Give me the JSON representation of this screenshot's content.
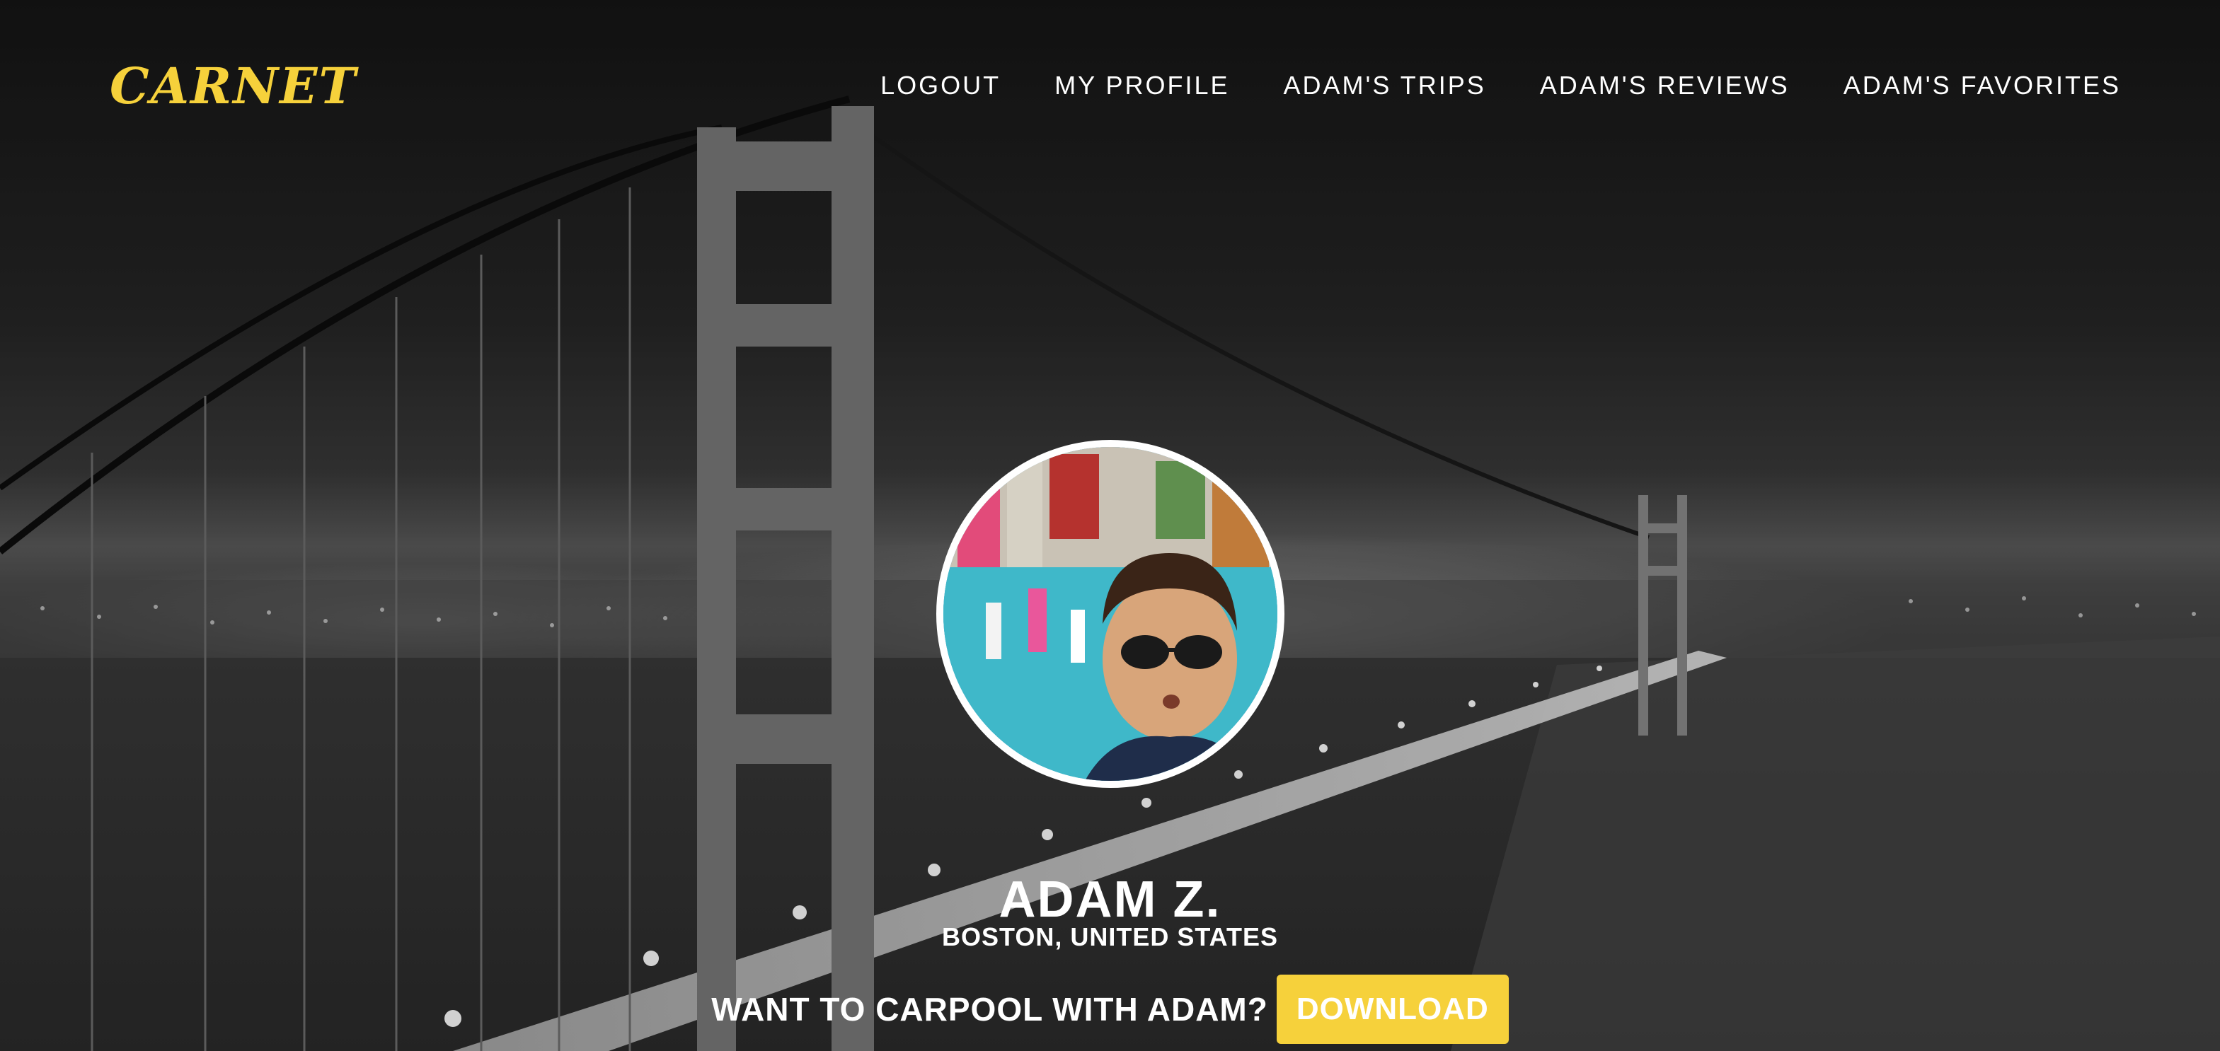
{
  "brand": {
    "logo_text": "CARNET",
    "accent_color": "#f6d13b"
  },
  "nav": {
    "items": [
      {
        "label": "LOGOUT"
      },
      {
        "label": "MY PROFILE"
      },
      {
        "label": "ADAM'S TRIPS"
      },
      {
        "label": "ADAM'S REVIEWS"
      },
      {
        "label": "ADAM'S FAVORITES"
      }
    ]
  },
  "profile": {
    "name": "ADAM Z.",
    "location": "BOSTON, UNITED STATES",
    "avatar_icon": "profile-photo"
  },
  "cta": {
    "prompt": "WANT TO CARPOOL WITH ADAM?",
    "button_label": "DOWNLOAD"
  }
}
